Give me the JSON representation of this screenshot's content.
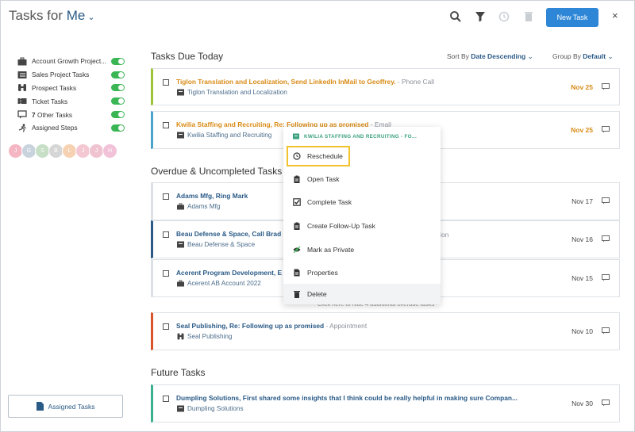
{
  "header": {
    "title_prefix": "Tasks for",
    "title_user": "Me",
    "new_task_label": "New Task",
    "close_label": "×"
  },
  "sidebar": {
    "filters": [
      {
        "label": "Account Growth Project...",
        "icon": "briefcase-icon"
      },
      {
        "label": "Sales Project Tasks",
        "icon": "list-icon"
      },
      {
        "label": "Prospect Tasks",
        "icon": "binoculars-icon"
      },
      {
        "label": "Ticket Tasks",
        "icon": "ticket-icon"
      },
      {
        "label_count": "7",
        "label": "Other Tasks",
        "icon": "comment-icon"
      },
      {
        "label": "Assigned Steps",
        "icon": "runner-icon"
      }
    ],
    "avatars": [
      {
        "initial": "J",
        "color": "#f4b6c2"
      },
      {
        "initial": "G",
        "color": "#c9d3de"
      },
      {
        "initial": "S",
        "color": "#c6dfc6"
      },
      {
        "initial": "B",
        "color": "#d6d6d6"
      },
      {
        "initial": "L",
        "color": "#f6d2b3"
      },
      {
        "initial": "J",
        "color": "#f3c8d3"
      },
      {
        "initial": "J",
        "color": "#efc3cf"
      },
      {
        "initial": "H",
        "color": "#f1c2d8"
      }
    ],
    "assigned_tasks_label": "Assigned Tasks"
  },
  "sort": {
    "sort_prefix": "Sort By",
    "sort_value": "Date Descending",
    "group_prefix": "Group By",
    "group_value": "Default"
  },
  "sections": {
    "due_today": "Tasks Due Today",
    "overdue": "Overdue & Uncompleted Tasks",
    "future": "Future Tasks"
  },
  "tasks": [
    {
      "title": "Tiglon Translation and Localization, Send LinkedIn InMail to Geoffrey.",
      "kind": "- Phone Call",
      "sub": "Tiglon Translation and Localization",
      "date": "Nov 25",
      "accent": "#9fc23c"
    },
    {
      "title": "Kwilia Staffing and Recruiting, Re: Following up as promised",
      "kind": "- Email",
      "sub": "Kwilia Staffing and Recruiting",
      "date": "Nov 25",
      "accent": "#4aa3c9"
    },
    {
      "title": "Adams Mfg, Ring Mark",
      "kind": "",
      "sub": "Adams Mfg",
      "date": "Nov 17",
      "accent": "#dde1e5"
    },
    {
      "title": "Beau Defense & Space, Call Brad",
      "kind": "",
      "kind_tail": "tration",
      "sub": "Beau Defense & Space",
      "date": "Nov 16",
      "accent": "#2a5a86"
    },
    {
      "title": "Acerent Program Development, E",
      "kind": "",
      "sub": "Acerent AB Account 2022",
      "date": "Nov 15",
      "accent": "#dde1e5"
    },
    {
      "title": "Seal Publishing, Re: Following up as promised",
      "kind": "- Appointment",
      "sub": "Seal Publishing",
      "date": "Nov 10",
      "accent": "#d9532b"
    },
    {
      "title": "Dumpling Solutions, First shared some insights that I think could be really helpful in making sure Compan...",
      "kind": "",
      "sub": "Dumpling Solutions",
      "date": "Nov 30",
      "accent": "#3ab08f"
    }
  ],
  "hide_link": "Click here to hide 4 additional overdue tasks",
  "context_menu": {
    "header": "KWILIA STAFFING AND RECRUITING - FO...",
    "items": [
      {
        "label": "Reschedule",
        "icon": "reschedule-icon"
      },
      {
        "label": "Open Task",
        "icon": "clipboard-icon"
      },
      {
        "label": "Complete Task",
        "icon": "checkbox-icon"
      },
      {
        "label": "Create Follow-Up Task",
        "icon": "clipboard-icon"
      },
      {
        "label": "Mark as Private",
        "icon": "eye-icon"
      },
      {
        "label": "Properties",
        "icon": "document-icon"
      },
      {
        "label": "Delete",
        "icon": "trash-icon"
      }
    ]
  }
}
